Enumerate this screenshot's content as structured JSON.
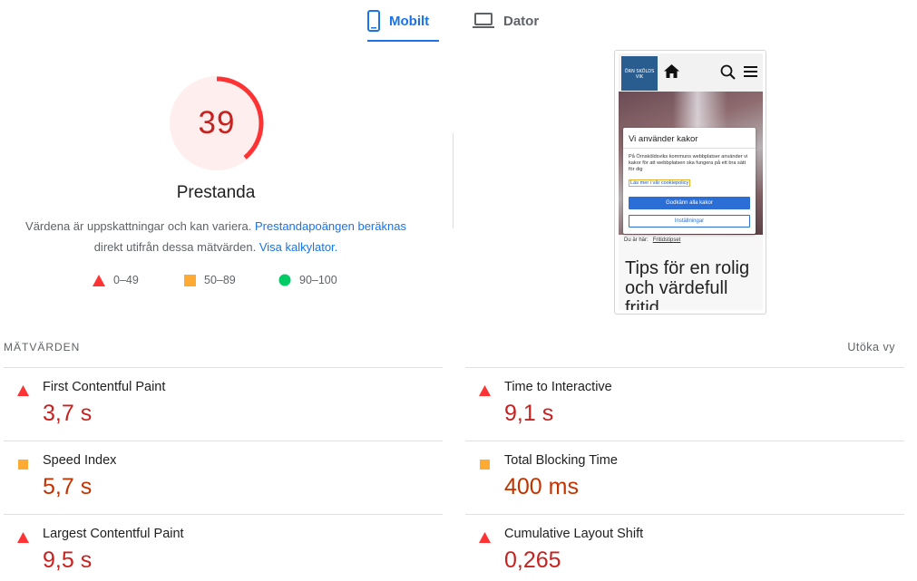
{
  "tabs": [
    {
      "label": "Mobilt",
      "icon": "smartphone-icon",
      "active": true
    },
    {
      "label": "Dator",
      "icon": "laptop-icon",
      "active": false
    }
  ],
  "gauge": {
    "score": "39",
    "score_fraction": 0.39,
    "title": "Prestanda",
    "color": "#ff3333",
    "bg_color": "#ffeeee"
  },
  "description": {
    "text_1": "Värdena är uppskattningar och kan variera.",
    "link_1": "Prestandapoängen beräknas",
    "text_2": "direkt utifrån dessa mätvärden.",
    "link_2": "Visa kalkylator."
  },
  "legend": [
    {
      "range": "0–49",
      "icon": "red-triangle-icon",
      "color": "#ff3333"
    },
    {
      "range": "50–89",
      "icon": "orange-square-icon",
      "color": "#ffaa33"
    },
    {
      "range": "90–100",
      "icon": "green-circle-icon",
      "color": "#00cc66"
    }
  ],
  "preview": {
    "logo_text": "ÖRN SKÖLDS VIK",
    "dialog_title": "Vi använder kakor",
    "dialog_text": "På Örnsköldsviks kommuns webbplatser använder vi kakor för att webbplatsen ska fungera på ett bra sätt för dig",
    "dialog_link": "Läs mer i vår cookiepolicy",
    "accept_label": "Godkänn alla kakor",
    "settings_label": "Inställningar",
    "breadcrumb_prefix": "Du är här:",
    "breadcrumb_link": "Fritidstipset",
    "heading": "Tips för en rolig och värdefull fritid"
  },
  "metrics": {
    "header": "MÄTVÄRDEN",
    "expand_label": "Utöka vy",
    "left": [
      {
        "name": "First Contentful Paint",
        "value": "3,7 s",
        "rating": "fail"
      },
      {
        "name": "Speed Index",
        "value": "5,7 s",
        "rating": "average"
      },
      {
        "name": "Largest Contentful Paint",
        "value": "9,5 s",
        "rating": "fail"
      }
    ],
    "right": [
      {
        "name": "Time to Interactive",
        "value": "9,1 s",
        "rating": "fail"
      },
      {
        "name": "Total Blocking Time",
        "value": "400 ms",
        "rating": "average"
      },
      {
        "name": "Cumulative Layout Shift",
        "value": "0,265",
        "rating": "fail"
      }
    ]
  },
  "colors": {
    "accent": "#1a73e8",
    "fail_text": "#c7221f",
    "average_text": "#c33300",
    "fail_icon": "#ff3333",
    "average_icon": "#ffaa33",
    "pass_icon": "#00cc66"
  }
}
